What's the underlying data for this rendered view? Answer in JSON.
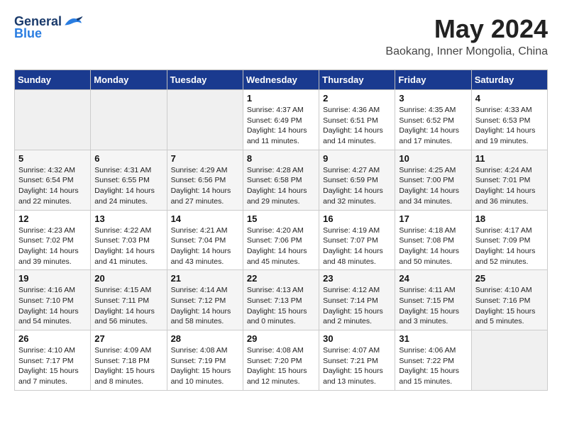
{
  "header": {
    "logo_general": "General",
    "logo_blue": "Blue",
    "month_title": "May 2024",
    "location": "Baokang, Inner Mongolia, China"
  },
  "days_of_week": [
    "Sunday",
    "Monday",
    "Tuesday",
    "Wednesday",
    "Thursday",
    "Friday",
    "Saturday"
  ],
  "weeks": [
    [
      {
        "day": "",
        "info": ""
      },
      {
        "day": "",
        "info": ""
      },
      {
        "day": "",
        "info": ""
      },
      {
        "day": "1",
        "info": "Sunrise: 4:37 AM\nSunset: 6:49 PM\nDaylight: 14 hours\nand 11 minutes."
      },
      {
        "day": "2",
        "info": "Sunrise: 4:36 AM\nSunset: 6:51 PM\nDaylight: 14 hours\nand 14 minutes."
      },
      {
        "day": "3",
        "info": "Sunrise: 4:35 AM\nSunset: 6:52 PM\nDaylight: 14 hours\nand 17 minutes."
      },
      {
        "day": "4",
        "info": "Sunrise: 4:33 AM\nSunset: 6:53 PM\nDaylight: 14 hours\nand 19 minutes."
      }
    ],
    [
      {
        "day": "5",
        "info": "Sunrise: 4:32 AM\nSunset: 6:54 PM\nDaylight: 14 hours\nand 22 minutes."
      },
      {
        "day": "6",
        "info": "Sunrise: 4:31 AM\nSunset: 6:55 PM\nDaylight: 14 hours\nand 24 minutes."
      },
      {
        "day": "7",
        "info": "Sunrise: 4:29 AM\nSunset: 6:56 PM\nDaylight: 14 hours\nand 27 minutes."
      },
      {
        "day": "8",
        "info": "Sunrise: 4:28 AM\nSunset: 6:58 PM\nDaylight: 14 hours\nand 29 minutes."
      },
      {
        "day": "9",
        "info": "Sunrise: 4:27 AM\nSunset: 6:59 PM\nDaylight: 14 hours\nand 32 minutes."
      },
      {
        "day": "10",
        "info": "Sunrise: 4:25 AM\nSunset: 7:00 PM\nDaylight: 14 hours\nand 34 minutes."
      },
      {
        "day": "11",
        "info": "Sunrise: 4:24 AM\nSunset: 7:01 PM\nDaylight: 14 hours\nand 36 minutes."
      }
    ],
    [
      {
        "day": "12",
        "info": "Sunrise: 4:23 AM\nSunset: 7:02 PM\nDaylight: 14 hours\nand 39 minutes."
      },
      {
        "day": "13",
        "info": "Sunrise: 4:22 AM\nSunset: 7:03 PM\nDaylight: 14 hours\nand 41 minutes."
      },
      {
        "day": "14",
        "info": "Sunrise: 4:21 AM\nSunset: 7:04 PM\nDaylight: 14 hours\nand 43 minutes."
      },
      {
        "day": "15",
        "info": "Sunrise: 4:20 AM\nSunset: 7:06 PM\nDaylight: 14 hours\nand 45 minutes."
      },
      {
        "day": "16",
        "info": "Sunrise: 4:19 AM\nSunset: 7:07 PM\nDaylight: 14 hours\nand 48 minutes."
      },
      {
        "day": "17",
        "info": "Sunrise: 4:18 AM\nSunset: 7:08 PM\nDaylight: 14 hours\nand 50 minutes."
      },
      {
        "day": "18",
        "info": "Sunrise: 4:17 AM\nSunset: 7:09 PM\nDaylight: 14 hours\nand 52 minutes."
      }
    ],
    [
      {
        "day": "19",
        "info": "Sunrise: 4:16 AM\nSunset: 7:10 PM\nDaylight: 14 hours\nand 54 minutes."
      },
      {
        "day": "20",
        "info": "Sunrise: 4:15 AM\nSunset: 7:11 PM\nDaylight: 14 hours\nand 56 minutes."
      },
      {
        "day": "21",
        "info": "Sunrise: 4:14 AM\nSunset: 7:12 PM\nDaylight: 14 hours\nand 58 minutes."
      },
      {
        "day": "22",
        "info": "Sunrise: 4:13 AM\nSunset: 7:13 PM\nDaylight: 15 hours\nand 0 minutes."
      },
      {
        "day": "23",
        "info": "Sunrise: 4:12 AM\nSunset: 7:14 PM\nDaylight: 15 hours\nand 2 minutes."
      },
      {
        "day": "24",
        "info": "Sunrise: 4:11 AM\nSunset: 7:15 PM\nDaylight: 15 hours\nand 3 minutes."
      },
      {
        "day": "25",
        "info": "Sunrise: 4:10 AM\nSunset: 7:16 PM\nDaylight: 15 hours\nand 5 minutes."
      }
    ],
    [
      {
        "day": "26",
        "info": "Sunrise: 4:10 AM\nSunset: 7:17 PM\nDaylight: 15 hours\nand 7 minutes."
      },
      {
        "day": "27",
        "info": "Sunrise: 4:09 AM\nSunset: 7:18 PM\nDaylight: 15 hours\nand 8 minutes."
      },
      {
        "day": "28",
        "info": "Sunrise: 4:08 AM\nSunset: 7:19 PM\nDaylight: 15 hours\nand 10 minutes."
      },
      {
        "day": "29",
        "info": "Sunrise: 4:08 AM\nSunset: 7:20 PM\nDaylight: 15 hours\nand 12 minutes."
      },
      {
        "day": "30",
        "info": "Sunrise: 4:07 AM\nSunset: 7:21 PM\nDaylight: 15 hours\nand 13 minutes."
      },
      {
        "day": "31",
        "info": "Sunrise: 4:06 AM\nSunset: 7:22 PM\nDaylight: 15 hours\nand 15 minutes."
      },
      {
        "day": "",
        "info": ""
      }
    ]
  ]
}
